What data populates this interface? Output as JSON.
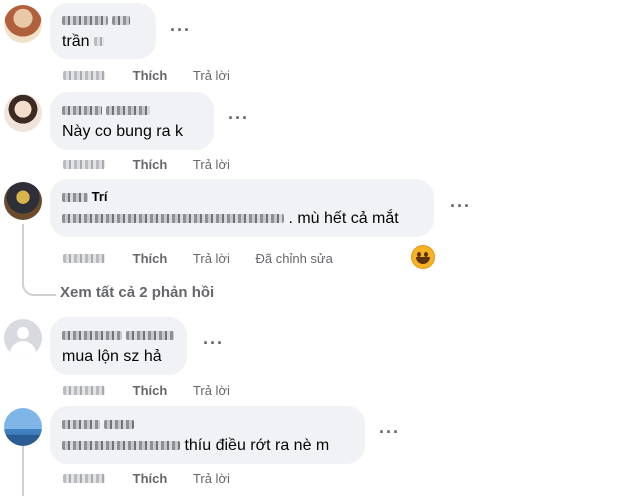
{
  "comments": [
    {
      "name_visible": "",
      "text": "trần",
      "like_label": "Thích",
      "reply_label": "Trả lời"
    },
    {
      "name_visible": "",
      "text": "Này co bung ra k",
      "like_label": "Thích",
      "reply_label": "Trả lời"
    },
    {
      "name_visible": "Trí",
      "text": ". mù hết cả mắt",
      "like_label": "Thích",
      "reply_label": "Trả lời",
      "edited_label": "Đã chỉnh sửa",
      "reaction_icon": "haha-emoji-icon"
    },
    {
      "name_visible": "",
      "text": "mua lộn sz hả",
      "like_label": "Thích",
      "reply_label": "Trả lời"
    },
    {
      "name_visible": "",
      "text": "thíu điều rớt ra nè m",
      "like_label": "Thích",
      "reply_label": "Trả lời"
    }
  ],
  "view_replies_label": "Xem tất cả 2 phản hồi",
  "more_label": "···",
  "colors": {
    "bubble": "#f0f2f5",
    "meta": "#65676b",
    "line": "#ced0d4"
  }
}
